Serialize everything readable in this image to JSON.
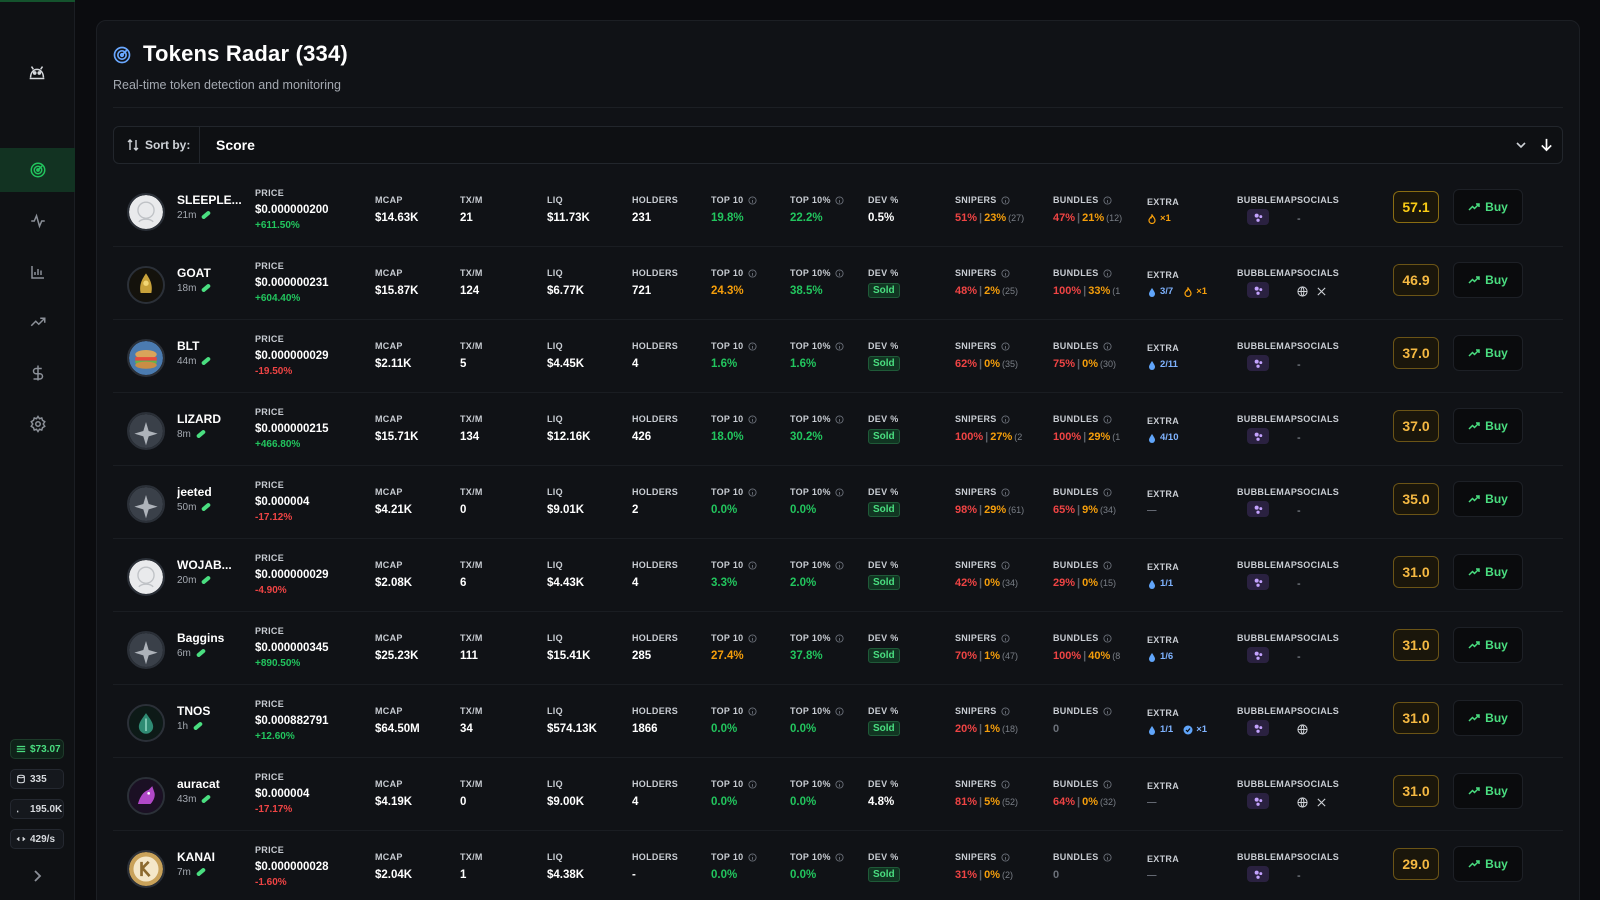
{
  "sidebar": {
    "chips": [
      {
        "value": "$73.07"
      },
      {
        "value": "335"
      },
      {
        "value": "195.0K"
      },
      {
        "value": "429/s"
      }
    ]
  },
  "header": {
    "title": "Tokens Radar (334)",
    "subtitle": "Real-time token detection and monitoring"
  },
  "sort": {
    "label": "Sort by:",
    "value": "Score"
  },
  "labels": {
    "price": "PRICE",
    "mcap": "MCAP",
    "txm": "TX/M",
    "liq": "LIQ",
    "holders": "HOLDERS",
    "top10": "TOP 10",
    "top10pct": "TOP 10%",
    "dev": "DEV %",
    "snipers": "SNIPERS",
    "bundles": "BUNDLES",
    "extra": "EXTRA",
    "bubblemap": "BUBBLEMAP",
    "socials": "SOCIALS",
    "buy": "Buy",
    "sold": "Sold"
  },
  "colors": {
    "accent": "#22c55e",
    "negative": "#ef4444",
    "warning": "#f59e0b",
    "score": "#f5b942"
  },
  "tokens": [
    {
      "name": "SLEEPLE...",
      "age": "21m",
      "avatar": "white",
      "price": "$0.000000200",
      "change": "+611.50%",
      "change_dir": "pos",
      "mcap": "$14.63K",
      "txm": "21",
      "liq": "$11.73K",
      "holders": "231",
      "top10": "19.8%",
      "top10_cls": "pos",
      "top10pct": "22.2%",
      "top10pct_cls": "pos",
      "dev": "0.5%",
      "dev_sold": false,
      "snipers_a": "51%",
      "snipers_b": "23%",
      "snipers_c": "(27)",
      "bundles_a": "47%",
      "bundles_b": "21%",
      "bundles_c": "(12)",
      "extra": [
        {
          "icon": "fire",
          "text": "×1"
        }
      ],
      "socials": "-",
      "social_icons": [],
      "score": "57.1"
    },
    {
      "name": "GOAT",
      "age": "18m",
      "avatar": "gold",
      "price": "$0.000000231",
      "change": "+604.40%",
      "change_dir": "pos",
      "mcap": "$15.87K",
      "txm": "124",
      "liq": "$6.77K",
      "holders": "721",
      "top10": "24.3%",
      "top10_cls": "ora",
      "top10pct": "38.5%",
      "top10pct_cls": "pos",
      "dev": "",
      "dev_sold": true,
      "snipers_a": "48%",
      "snipers_b": "2%",
      "snipers_c": "(25)",
      "bundles_a": "100%",
      "bundles_b": "33%",
      "bundles_c": "(1",
      "extra": [
        {
          "icon": "drop",
          "text": "3/7"
        },
        {
          "icon": "fire",
          "text": "×1"
        }
      ],
      "socials": "",
      "social_icons": [
        "globe",
        "x"
      ],
      "score": "46.9"
    },
    {
      "name": "BLT",
      "age": "44m",
      "avatar": "food",
      "price": "$0.000000029",
      "change": "-19.50%",
      "change_dir": "neg",
      "mcap": "$2.11K",
      "txm": "5",
      "liq": "$4.45K",
      "holders": "4",
      "top10": "1.6%",
      "top10_cls": "pos",
      "top10pct": "1.6%",
      "top10pct_cls": "pos",
      "dev": "",
      "dev_sold": true,
      "snipers_a": "62%",
      "snipers_b": "0%",
      "snipers_c": "(35)",
      "bundles_a": "75%",
      "bundles_b": "0%",
      "bundles_c": "(30)",
      "extra": [
        {
          "icon": "drop",
          "text": "2/11"
        }
      ],
      "socials": "-",
      "social_icons": [],
      "score": "37.0"
    },
    {
      "name": "LIZARD",
      "age": "8m",
      "avatar": "placeholder",
      "price": "$0.000000215",
      "change": "+466.80%",
      "change_dir": "pos",
      "mcap": "$15.71K",
      "txm": "134",
      "liq": "$12.16K",
      "holders": "426",
      "top10": "18.0%",
      "top10_cls": "pos",
      "top10pct": "30.2%",
      "top10pct_cls": "pos",
      "dev": "",
      "dev_sold": true,
      "snipers_a": "100%",
      "snipers_b": "27%",
      "snipers_c": "(2",
      "bundles_a": "100%",
      "bundles_b": "29%",
      "bundles_c": "(1",
      "extra": [
        {
          "icon": "drop",
          "text": "4/10"
        }
      ],
      "socials": "-",
      "social_icons": [],
      "score": "37.0"
    },
    {
      "name": "jeeted",
      "age": "50m",
      "avatar": "placeholder",
      "price": "$0.000004",
      "change": "-17.12%",
      "change_dir": "neg",
      "mcap": "$4.21K",
      "txm": "0",
      "liq": "$9.01K",
      "holders": "2",
      "top10": "0.0%",
      "top10_cls": "pos",
      "top10pct": "0.0%",
      "top10pct_cls": "pos",
      "dev": "",
      "dev_sold": true,
      "snipers_a": "98%",
      "snipers_b": "29%",
      "snipers_c": "(61)",
      "bundles_a": "65%",
      "bundles_b": "9%",
      "bundles_c": "(34)",
      "extra": [
        {
          "icon": "none",
          "text": "—"
        }
      ],
      "socials": "-",
      "social_icons": [],
      "score": "35.0"
    },
    {
      "name": "WOJAB...",
      "age": "20m",
      "avatar": "white",
      "price": "$0.000000029",
      "change": "-4.90%",
      "change_dir": "neg",
      "mcap": "$2.08K",
      "txm": "6",
      "liq": "$4.43K",
      "holders": "4",
      "top10": "3.3%",
      "top10_cls": "pos",
      "top10pct": "2.0%",
      "top10pct_cls": "pos",
      "dev": "",
      "dev_sold": true,
      "snipers_a": "42%",
      "snipers_b": "0%",
      "snipers_c": "(34)",
      "bundles_a": "29%",
      "bundles_b": "0%",
      "bundles_c": "(15)",
      "extra": [
        {
          "icon": "drop",
          "text": "1/1"
        }
      ],
      "socials": "-",
      "social_icons": [],
      "score": "31.0"
    },
    {
      "name": "Baggins",
      "age": "6m",
      "avatar": "placeholder",
      "price": "$0.000000345",
      "change": "+890.50%",
      "change_dir": "pos",
      "mcap": "$25.23K",
      "txm": "111",
      "liq": "$15.41K",
      "holders": "285",
      "top10": "27.4%",
      "top10_cls": "ora",
      "top10pct": "37.8%",
      "top10pct_cls": "pos",
      "dev": "",
      "dev_sold": true,
      "snipers_a": "70%",
      "snipers_b": "1%",
      "snipers_c": "(47)",
      "bundles_a": "100%",
      "bundles_b": "40%",
      "bundles_c": "(8",
      "extra": [
        {
          "icon": "drop",
          "text": "1/6"
        }
      ],
      "socials": "-",
      "social_icons": [],
      "score": "31.0"
    },
    {
      "name": "TNOS",
      "age": "1h",
      "avatar": "teal",
      "price": "$0.000882791",
      "change": "+12.60%",
      "change_dir": "pos",
      "mcap": "$64.50M",
      "txm": "34",
      "liq": "$574.13K",
      "holders": "1866",
      "top10": "0.0%",
      "top10_cls": "pos",
      "top10pct": "0.0%",
      "top10pct_cls": "pos",
      "dev": "",
      "dev_sold": true,
      "snipers_a": "20%",
      "snipers_b": "1%",
      "snipers_c": "(18)",
      "bundles_a": "0",
      "bundles_b": "",
      "bundles_c": "",
      "extra": [
        {
          "icon": "drop",
          "text": "1/1"
        },
        {
          "icon": "badge",
          "text": "×1"
        }
      ],
      "socials": "",
      "social_icons": [
        "globe"
      ],
      "score": "31.0"
    },
    {
      "name": "auracat",
      "age": "43m",
      "avatar": "purple",
      "price": "$0.000004",
      "change": "-17.17%",
      "change_dir": "neg",
      "mcap": "$4.19K",
      "txm": "0",
      "liq": "$9.00K",
      "holders": "4",
      "top10": "0.0%",
      "top10_cls": "pos",
      "top10pct": "0.0%",
      "top10pct_cls": "pos",
      "dev": "4.8%",
      "dev_sold": false,
      "snipers_a": "81%",
      "snipers_b": "5%",
      "snipers_c": "(52)",
      "bundles_a": "64%",
      "bundles_b": "0%",
      "bundles_c": "(32)",
      "extra": [
        {
          "icon": "none",
          "text": "—"
        }
      ],
      "socials": "",
      "social_icons": [
        "globe",
        "x"
      ],
      "score": "31.0"
    },
    {
      "name": "KANAI",
      "age": "7m",
      "avatar": "k",
      "price": "$0.000000028",
      "change": "-1.60%",
      "change_dir": "neg",
      "mcap": "$2.04K",
      "txm": "1",
      "liq": "$4.38K",
      "holders": "-",
      "top10": "0.0%",
      "top10_cls": "pos",
      "top10pct": "0.0%",
      "top10pct_cls": "pos",
      "dev": "",
      "dev_sold": true,
      "snipers_a": "31%",
      "snipers_b": "0%",
      "snipers_c": "(2)",
      "bundles_a": "0",
      "bundles_b": "",
      "bundles_c": "",
      "extra": [
        {
          "icon": "none",
          "text": "—"
        }
      ],
      "socials": "-",
      "social_icons": [],
      "score": "29.0"
    }
  ]
}
